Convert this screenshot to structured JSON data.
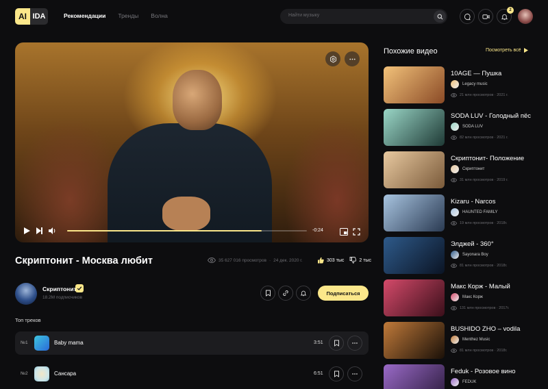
{
  "logo": {
    "left": "AI",
    "right": "IDA"
  },
  "nav": [
    "Рекомендации",
    "Тренды",
    "Волна"
  ],
  "search": {
    "placeholder": "Найти музыку"
  },
  "notifications": {
    "count": "2"
  },
  "player": {
    "time": "-0:24",
    "progress": 0.81
  },
  "video": {
    "title": "Скриптонит - Москва любит",
    "views": "35 627 016 просмотров",
    "date": "24 дек. 2020 г.",
    "likes": "303 тыс",
    "dislikes": "2 тыс"
  },
  "channel": {
    "name": "Скриптонит",
    "subs": "18.2М подписчиков",
    "subscribe": "Подписаться"
  },
  "top_tracks": {
    "title": "Топ треков",
    "items": [
      {
        "num": "№1",
        "name": "Baby mama",
        "duration": "3:51"
      },
      {
        "num": "№2",
        "name": "Сансара",
        "duration": "6:51"
      }
    ]
  },
  "related": {
    "title": "Похожие видео",
    "see_all": "Посмотреть всё",
    "items": [
      {
        "title": "10AGE — Пушка",
        "channel": "Legacy music",
        "meta": "21 млн просмотров · 2021 г.",
        "colors": [
          "#f2c27a",
          "#8a4a26"
        ]
      },
      {
        "title": "SODA LUV - Голодный пёс",
        "channel": "SODA LUV",
        "meta": "82 млн просмотров · 2021 г.",
        "colors": [
          "#9ad6c6",
          "#1f3a36"
        ]
      },
      {
        "title": "Скриптонит- Положение",
        "channel": "Скриптонит",
        "meta": "31 млн просмотров · 2019 г.",
        "colors": [
          "#e8c9a0",
          "#7a5a3a"
        ]
      },
      {
        "title": "Kizaru - Narcos",
        "channel": "HAUNTED FAMILY",
        "meta": "19 млн просмотров · 2018г.",
        "colors": [
          "#a8c4e0",
          "#2a3a52"
        ]
      },
      {
        "title": "Элджей - 360°",
        "channel": "Sayonara Boy",
        "meta": "81 млн просмотров · 2018г.",
        "colors": [
          "#2e5a8a",
          "#0b1424"
        ]
      },
      {
        "title": "Макс Корж - Малый",
        "channel": "Макс Корж",
        "meta": "131 млн просмотров · 2017г.",
        "colors": [
          "#d44a6a",
          "#3a0f1a"
        ]
      },
      {
        "title": "BUSHIDO ZHO – vodila",
        "channel": "Menthez Music",
        "meta": "81 млн просмотров · 2018г.",
        "colors": [
          "#c07a3a",
          "#1a1008"
        ]
      },
      {
        "title": "Feduk - Розовое вино",
        "channel": "FEDUK",
        "meta": "",
        "colors": [
          "#9a6ac8",
          "#2a1a3a"
        ]
      }
    ]
  }
}
